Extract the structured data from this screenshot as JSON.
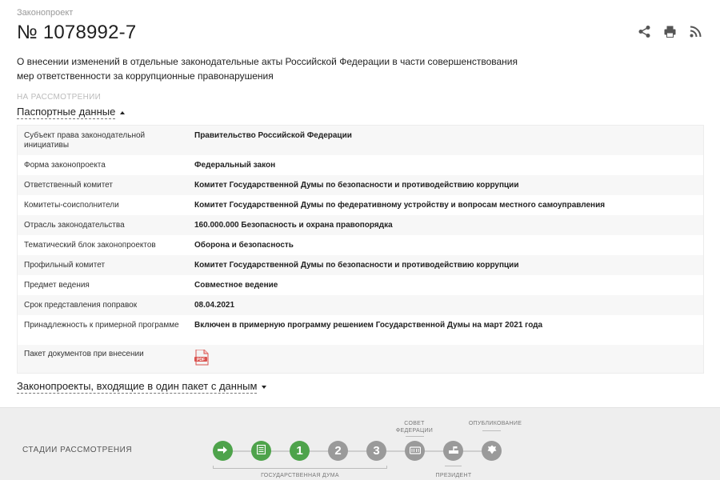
{
  "header": {
    "kicker": "Законопроект",
    "number": "№ 1078992-7",
    "title": "О внесении изменений в отдельные законодательные акты Российской Федерации в части совершенствования мер ответственности за коррупционные правонарушения",
    "status": "НА РАССМОТРЕНИИ"
  },
  "actions": {
    "share_icon": "share-icon",
    "print_icon": "print-icon",
    "rss_icon": "rss-icon"
  },
  "passport": {
    "toggle_label": "Паспортные данные",
    "rows": [
      {
        "key": "Субъект права законодательной инициативы",
        "value": "Правительство Российской Федерации"
      },
      {
        "key": "Форма законопроекта",
        "value": "Федеральный закон"
      },
      {
        "key": "Ответственный комитет",
        "value": "Комитет Государственной Думы по безопасности и противодействию коррупции"
      },
      {
        "key": "Комитеты-соисполнители",
        "value": "Комитет Государственной Думы по федеративному устройству и вопросам местного самоуправления"
      },
      {
        "key": "Отрасль законодательства",
        "value": "160.000.000 Безопасность и охрана правопорядка"
      },
      {
        "key": "Тематический блок законопроектов",
        "value": "Оборона и безопасность"
      },
      {
        "key": "Профильный комитет",
        "value": "Комитет Государственной Думы по безопасности и противодействию коррупции"
      },
      {
        "key": "Предмет ведения",
        "value": "Совместное ведение"
      },
      {
        "key": "Срок представления поправок",
        "value": "08.04.2021"
      },
      {
        "key": "Принадлежность к примерной программе",
        "value": "Включен в примерную программу решением Государственной Думы на март 2021 года"
      },
      {
        "key": "Пакет документов при внесении",
        "value": "",
        "icon": "pdf-icon"
      }
    ]
  },
  "package": {
    "toggle_label": "Законопроекты, входящие в один пакет с данным"
  },
  "stages": {
    "title": "СТАДИИ РАССМОТРЕНИЯ",
    "items": [
      {
        "label": "",
        "icon": "arrow-right-icon",
        "state": "done"
      },
      {
        "label": "",
        "icon": "document-icon",
        "state": "done"
      },
      {
        "label": "1",
        "icon": "",
        "state": "done"
      },
      {
        "label": "2",
        "icon": "",
        "state": "pending"
      },
      {
        "label": "3",
        "icon": "",
        "state": "pending"
      },
      {
        "label": "",
        "icon": "federation-council-icon",
        "state": "pending"
      },
      {
        "label": "",
        "icon": "president-icon",
        "state": "pending"
      },
      {
        "label": "",
        "icon": "emblem-icon",
        "state": "pending"
      }
    ],
    "captions": {
      "duma": "ГОСУДАРСТВЕННАЯ ДУМА",
      "council_line1": "СОВЕТ",
      "council_line2": "ФЕДЕРАЦИИ",
      "president": "ПРЕЗИДЕНТ",
      "publication": "ОПУБЛИКОВАНИЕ"
    }
  },
  "colors": {
    "stage_done": "#4ea34b",
    "stage_pending": "#9a9a9a",
    "pdf": "#d9534f"
  }
}
